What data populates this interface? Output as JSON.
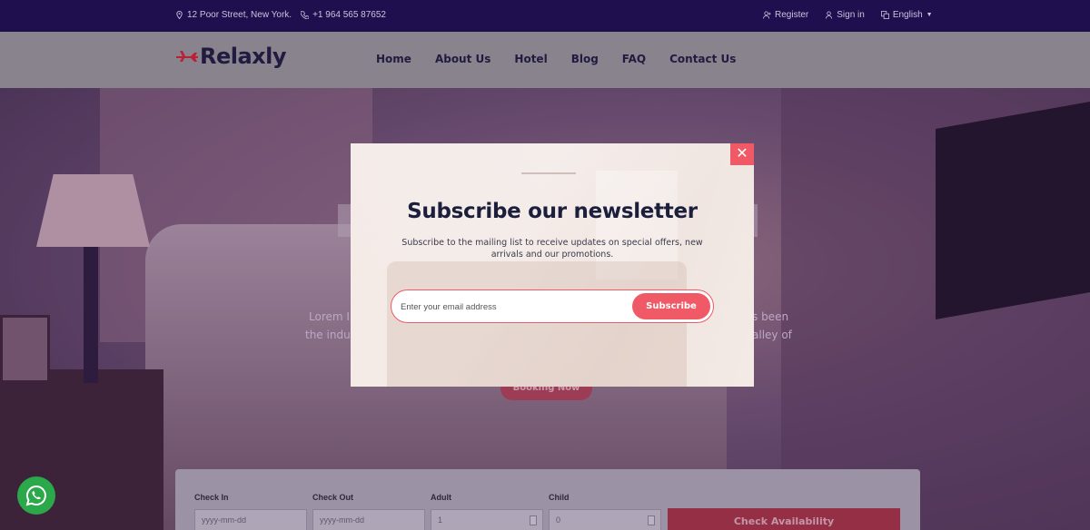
{
  "topbar": {
    "address": "12 Poor Street, New York.",
    "phone": "+1 964 565 87652",
    "register": "Register",
    "signin": "Sign in",
    "language": "English"
  },
  "header": {
    "logo": "Relaxly",
    "nav": [
      "Home",
      "About Us",
      "Hotel",
      "Blog",
      "FAQ",
      "Contact Us"
    ]
  },
  "hero": {
    "text_left_1": "Lorem Ip",
    "text_left_2": "the indus",
    "text_right_1": "s been",
    "text_right_2": "alley of",
    "booking_label": "Booking Now"
  },
  "availability": {
    "check_in_label": "Check In",
    "check_in_placeholder": "yyyy-mm-dd",
    "check_out_label": "Check Out",
    "check_out_placeholder": "yyyy-mm-dd",
    "adult_label": "Adult",
    "adult_value": "1",
    "child_label": "Child",
    "child_value": "0",
    "button": "Check Availability"
  },
  "modal": {
    "close": "✕",
    "title": "Subscribe our newsletter",
    "description": "Subscribe to the mailing list to receive updates on special offers, new arrivals and our promotions.",
    "email_placeholder": "Enter your email address",
    "subscribe": "Subscribe"
  },
  "colors": {
    "accent": "#f05a67",
    "topbar_bg": "#1f0f4e",
    "whatsapp": "#2aa84a"
  }
}
